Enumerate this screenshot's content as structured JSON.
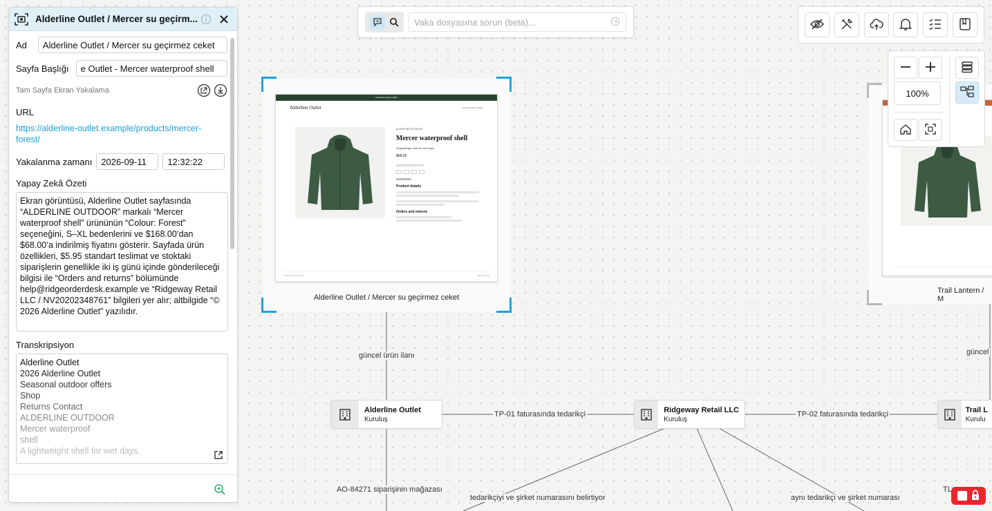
{
  "panel": {
    "title": "Alderline Outlet / Mercer su geçirm...",
    "name_label": "Ad",
    "name_value": "Alderline Outlet / Mercer su geçirmez ceket",
    "page_title_label": "Sayfa Başlığı",
    "page_title_value": "e Outlet - Mercer waterproof shell",
    "capture_type": "Tam Sayfa Ekran Yakalama",
    "url_label": "URL",
    "url_value": "https://alderline-outlet.example/products/mercer-forest/",
    "captured_label": "Yakalanma zamanı",
    "captured_date": "2026-09-11",
    "captured_time": "12:32:22",
    "ai_summary_label": "Yapay Zekâ Özeti",
    "ai_summary": "Ekran görüntüsü, Alderline Outlet sayfasında “ALDERLINE OUTDOOR” markalı “Mercer waterproof shell” ürününün “Colour: Forest” seçeneğini, S–XL bedenlerini ve $168.00’dan $68.00’a indirilmiş fiyatını gösterir. Sayfada ürün özellikleri, $5.95 standart teslimat ve stoktaki siparişlerin genellikle iki iş günü içinde gönderileceği bilgisi ile “Orders and returns” bölümünde help@ridgeorderdesk.example ve “Ridgeway Retail LLC / NV20202348761” bilgileri yer alır; altbilgide “© 2026 Alderline Outlet” yazılıdır.",
    "transcription_label": "Transkripsiyon",
    "transcription_lines": [
      "Alderline Outlet",
      "2026 Alderline Outlet",
      "Seasonal outdoor offers",
      "Shop",
      "Returns Contact",
      "ALDERLINE OUTDOOR",
      "Mercer waterproof",
      "shell",
      "A lightweight shell for wet days."
    ]
  },
  "search": {
    "placeholder": "Vaka dosyasına sorun (beta)..."
  },
  "zoom": {
    "level": "100%"
  },
  "screenshots": [
    {
      "caption": "Alderline Outlet / Mercer su geçirmez ceket",
      "page": {
        "topbar": "Seasonal outdoor offers",
        "brand": "Alderline Outlet",
        "nav": "Shop   Returns   Contact",
        "kicker": "ALDERLINE OUTDOOR",
        "product_title": "Mercer waterproof shell",
        "tagline": "A lightweight shell for wet days.",
        "price": "$68.00",
        "details_heading": "Product details",
        "orders_heading": "Orders and returns",
        "footer_left": "© 2026 Alderline Outlet",
        "footer_right": "Shop  Returns"
      }
    },
    {
      "caption": "Trail Lantern / M"
    }
  ],
  "entities": [
    {
      "name": "Alderline Outlet",
      "type": "Kuruluş"
    },
    {
      "name": "Ridgeway Retail LLC",
      "type": "Kuruluş"
    },
    {
      "name": "Trail L",
      "type": "Kurulu"
    }
  ],
  "edge_labels": {
    "current_listing": "güncel ürün ilanı",
    "current_right": "güncel",
    "tp01": "TP-01 faturasında tedarikçi",
    "tp02": "TP-02 faturasında tedarikçi",
    "order_store": "AO-84271 siparişinin mağazası",
    "supplier_company": "tedarikçiyi ve şirket numarasını belirtiyor",
    "same_supplier": "aynı tedarikçi ve şirket numarası",
    "tl_partial": "TL"
  },
  "colors": {
    "accent": "#1aa3d9",
    "panel_header": "#dff0f7",
    "lock_red": "#e8262d",
    "jacket_green": "#3d5a43"
  }
}
